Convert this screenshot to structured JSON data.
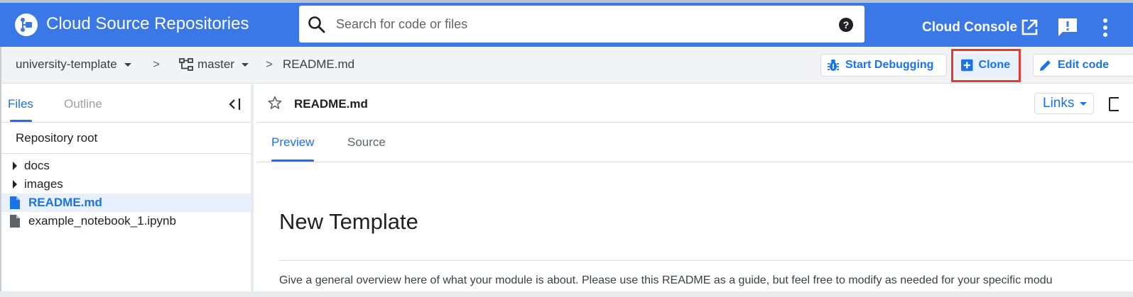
{
  "header": {
    "app_title": "Cloud Source Repositories",
    "search_placeholder": "Search for code or files",
    "help_label": "?",
    "console_link": "Cloud Console"
  },
  "breadcrumb": {
    "repo": "university-template",
    "branch": "master",
    "file": "README.md",
    "separator": ">"
  },
  "actions": {
    "debug_label": "Start Debugging",
    "clone_label": "Clone",
    "edit_label": "Edit code"
  },
  "sidebar": {
    "tabs": [
      {
        "label": "Files",
        "active": true
      },
      {
        "label": "Outline",
        "active": false
      }
    ],
    "root_label": "Repository root",
    "items": [
      {
        "label": "docs",
        "type": "folder"
      },
      {
        "label": "images",
        "type": "folder"
      },
      {
        "label": "README.md",
        "type": "file",
        "selected": true
      },
      {
        "label": "example_notebook_1.ipynb",
        "type": "file"
      }
    ]
  },
  "main": {
    "file_title": "README.md",
    "links_label": "Links",
    "tabs": [
      {
        "label": "Preview",
        "active": true
      },
      {
        "label": "Source",
        "active": false
      }
    ],
    "heading": "New Template",
    "paragraph": "Give a general overview here of what your module is about. Please use this README as a guide, but feel free to modify as needed for your specific modu"
  },
  "colors": {
    "header_bg": "#3b78e7",
    "accent": "#1a73e8",
    "highlight": "#e53935"
  },
  "icons": [
    "repo-logo-icon",
    "search-icon",
    "help-icon",
    "open-external-icon",
    "feedback-icon",
    "more-vert-icon",
    "branch-icon",
    "bug-icon",
    "add-box-icon",
    "pencil-icon",
    "collapse-panel-icon",
    "file-icon",
    "star-icon"
  ]
}
